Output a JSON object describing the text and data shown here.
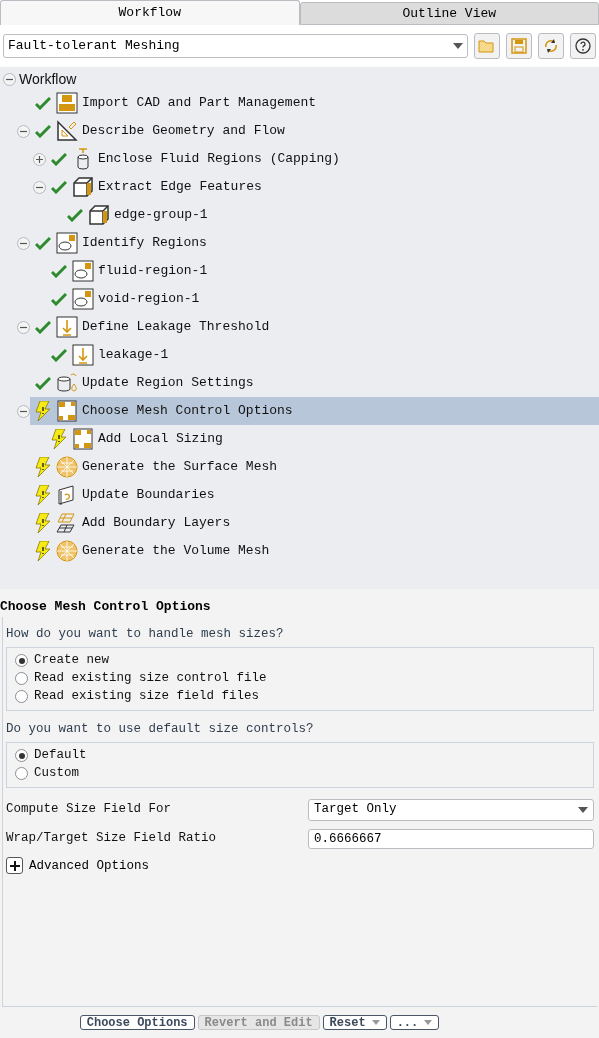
{
  "tabs": [
    {
      "label": "Workflow",
      "selected": true
    },
    {
      "label": "Outline View",
      "selected": false
    }
  ],
  "workflow_select": {
    "value": "Fault-tolerant Meshing"
  },
  "toolbar": [
    {
      "kind": "open"
    },
    {
      "kind": "save"
    },
    {
      "kind": "refresh"
    },
    {
      "kind": "help"
    }
  ],
  "tree": {
    "label": "Workflow",
    "expanded": true,
    "children": [
      {
        "label": "Import CAD and Part Management",
        "done": true,
        "kind": "cad",
        "selected": false
      },
      {
        "label": "Describe Geometry and Flow",
        "done": true,
        "kind": "triangle",
        "selected": false,
        "expanded": true,
        "children": [
          {
            "label": "Enclose Fluid Regions (Capping)",
            "done": true,
            "kind": "cylinder",
            "selected": false,
            "expanded": false
          },
          {
            "label": "Extract Edge Features",
            "done": true,
            "kind": "box",
            "selected": false,
            "expanded": true,
            "children": [
              {
                "label": "edge-group-1",
                "done": true,
                "kind": "box",
                "selected": false
              }
            ]
          }
        ]
      },
      {
        "label": "Identify Regions",
        "done": true,
        "kind": "region",
        "selected": false,
        "expanded": true,
        "children": [
          {
            "label": "fluid-region-1",
            "done": true,
            "kind": "region",
            "selected": false
          },
          {
            "label": "void-region-1",
            "done": true,
            "kind": "region",
            "selected": false
          }
        ]
      },
      {
        "label": "Define Leakage Threshold",
        "done": true,
        "kind": "leakage",
        "selected": false,
        "expanded": true,
        "children": [
          {
            "label": "leakage-1",
            "done": true,
            "kind": "leakage",
            "selected": false
          }
        ]
      },
      {
        "label": "Update Region Settings",
        "done": true,
        "kind": "drop",
        "selected": false
      },
      {
        "label": "Choose Mesh Control Options",
        "done": false,
        "kind": "control",
        "selected": true,
        "expanded": true,
        "children": [
          {
            "label": "Add Local Sizing",
            "done": false,
            "kind": "control",
            "selected": false
          }
        ]
      },
      {
        "label": "Generate the Surface Mesh",
        "done": false,
        "kind": "sphere",
        "selected": false
      },
      {
        "label": "Update Boundaries",
        "done": false,
        "kind": "boundary",
        "selected": false
      },
      {
        "label": "Add Boundary Layers",
        "done": false,
        "kind": "layers",
        "selected": false
      },
      {
        "label": "Generate the Volume Mesh",
        "done": false,
        "kind": "sphere",
        "selected": false
      }
    ]
  },
  "panel": {
    "title": "Choose Mesh Control Options",
    "questions": [
      {
        "label": "How do you want to handle mesh sizes?",
        "options": [
          {
            "label": "Create new",
            "selected": true
          },
          {
            "label": "Read existing size control file",
            "selected": false
          },
          {
            "label": "Read existing size field files",
            "selected": false
          }
        ]
      },
      {
        "label": "Do you want to use default size controls?",
        "options": [
          {
            "label": "Default",
            "selected": true
          },
          {
            "label": "Custom",
            "selected": false
          }
        ]
      }
    ],
    "fields": [
      {
        "kind": "select",
        "label": "Compute Size Field For",
        "value": "Target Only"
      },
      {
        "kind": "input",
        "label": "Wrap/Target Size Field Ratio",
        "value": "0.6666667"
      }
    ],
    "advanced": {
      "label": "Advanced Options",
      "expanded": false
    }
  },
  "buttons": [
    {
      "label": "Choose Options",
      "disabled": false,
      "dropdown": false
    },
    {
      "label": "Revert and Edit",
      "disabled": true,
      "dropdown": false
    },
    {
      "label": "Reset",
      "disabled": false,
      "dropdown": true
    },
    {
      "label": "...",
      "disabled": false,
      "dropdown": true
    }
  ]
}
